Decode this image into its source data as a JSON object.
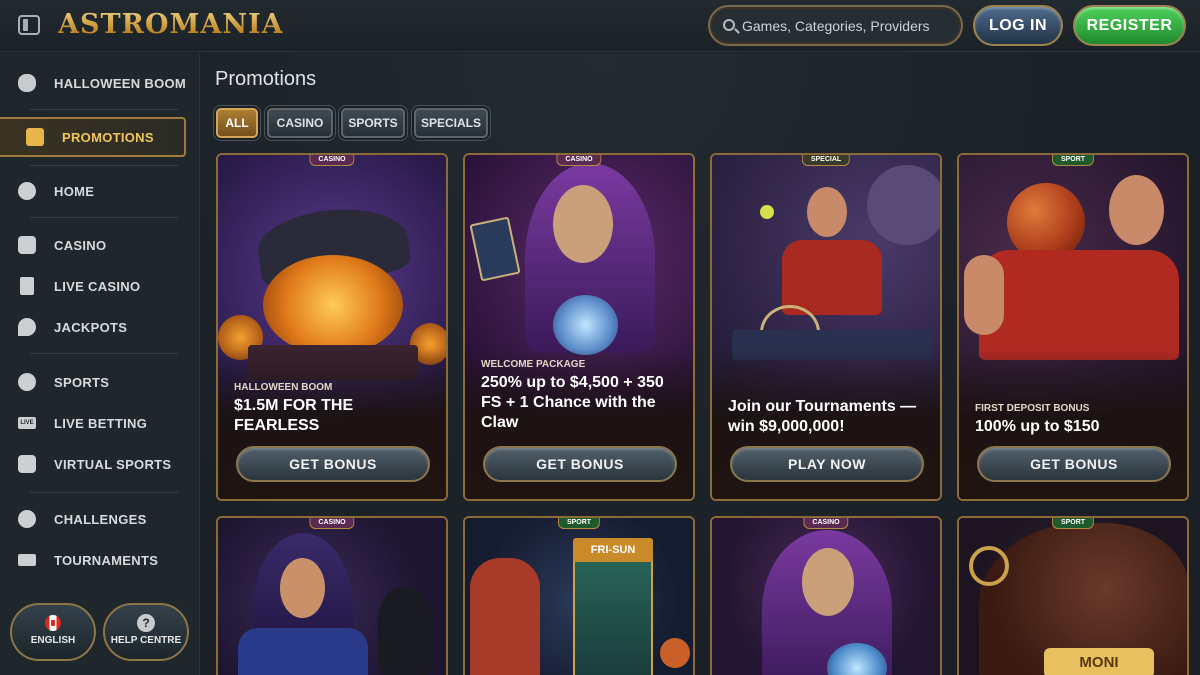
{
  "header": {
    "logo_text": "ASTROMANIA",
    "search_placeholder": "Games, Categories, Providers",
    "login_label": "LOG IN",
    "register_label": "REGISTER"
  },
  "sidebar": {
    "items": [
      {
        "label": "HALLOWEEN BOOM",
        "icon": "pumpkin-icon"
      },
      {
        "label": "PROMOTIONS",
        "icon": "gift-icon",
        "active": true
      },
      {
        "label": "HOME",
        "icon": "home-icon"
      },
      {
        "label": "CASINO",
        "icon": "slot-machine-icon"
      },
      {
        "label": "LIVE CASINO",
        "icon": "card-icon"
      },
      {
        "label": "JACKPOTS",
        "icon": "clover-icon"
      },
      {
        "label": "SPORTS",
        "icon": "soccer-ball-icon"
      },
      {
        "label": "LIVE BETTING",
        "icon": "live-icon"
      },
      {
        "label": "VIRTUAL SPORTS",
        "icon": "virtual-ball-icon"
      },
      {
        "label": "CHALLENGES",
        "icon": "medal-icon"
      },
      {
        "label": "TOURNAMENTS",
        "icon": "podium-icon"
      }
    ],
    "language_label": "ENGLISH",
    "help_label": "HELP CENTRE",
    "help_glyph": "?"
  },
  "main": {
    "title": "Promotions",
    "filters": [
      {
        "label": "ALL",
        "active": true
      },
      {
        "label": "CASINO"
      },
      {
        "label": "SPORTS"
      },
      {
        "label": "SPECIALS"
      }
    ],
    "cards": [
      {
        "tag": "CASINO",
        "subtitle": "HALLOWEEN BOOM",
        "headline": "$1.5M FOR THE FEARLESS",
        "button": "GET BONUS"
      },
      {
        "tag": "CASINO",
        "subtitle": "WELCOME PACKAGE",
        "headline": "250% up to $4,500 + 350 FS + 1 Chance with the Claw",
        "button": "GET BONUS"
      },
      {
        "tag": "SPECIAL",
        "subtitle": "",
        "headline": "Join our Tournaments — win $9,000,000!",
        "button": "PLAY NOW"
      },
      {
        "tag": "SPORT",
        "subtitle": "FIRST DEPOSIT BONUS",
        "headline": "100% up to $150",
        "button": "GET BONUS"
      },
      {
        "tag": "CASINO"
      },
      {
        "tag": "SPORT",
        "sign": "FRI-SUN"
      },
      {
        "tag": "CASINO"
      },
      {
        "tag": "SPORT",
        "sign": "MONI"
      }
    ]
  },
  "colors": {
    "accent_gold": "#d6a656",
    "register_green": "#2fa83c",
    "login_blue": "#3b5575",
    "background": "#1b2126"
  }
}
